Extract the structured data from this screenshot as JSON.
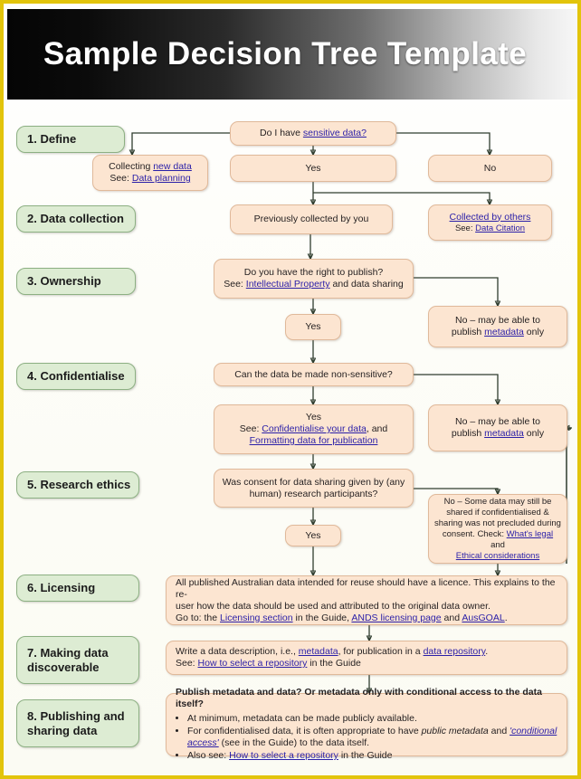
{
  "header": {
    "title": "Sample Decision Tree Template"
  },
  "theme": {
    "border_color": "#e2c40b",
    "stage_fill": "#ddecd3",
    "flow_fill": "#fce5d1",
    "link_color": "#2a1fa8",
    "connector_color": "#2f3d2f"
  },
  "stages": [
    {
      "label": "1. Define"
    },
    {
      "label": "2. Data collection"
    },
    {
      "label": "3. Ownership"
    },
    {
      "label": "4. Confidentialise"
    },
    {
      "label": "5. Research ethics"
    },
    {
      "label": "6. Licensing"
    },
    {
      "label": "7. Making data discoverable"
    },
    {
      "label": "8. Publishing and sharing data"
    }
  ],
  "nodes": {
    "q_sensitive": {
      "pre": "Do I have ",
      "link": "sensitive data?",
      "post": ""
    },
    "collecting_new": {
      "line1_pre": "Collecting ",
      "line1_link": "new data",
      "line2_pre": "See: ",
      "line2_link": "Data planning"
    },
    "yes_sensitive": {
      "label": "Yes"
    },
    "no_sensitive": {
      "label": "No"
    },
    "prev_collected": {
      "label": "Previously collected by you"
    },
    "collected_others": {
      "line1_link": "Collected by others",
      "line2_pre": "See: ",
      "line2_link": "Data Citation"
    },
    "q_right_publish": {
      "line1": "Do you have the right to publish?",
      "line2_pre": "See: ",
      "line2_link": "Intellectual Property",
      "line2_post": " and data sharing"
    },
    "yes_ownership": {
      "label": "Yes"
    },
    "no_metadata_1": {
      "line1": "No – may be able to",
      "line2_pre": "publish ",
      "line2_link": "metadata",
      "line2_post": " only"
    },
    "q_non_sensitive": {
      "label": "Can the data be made non-sensitive?"
    },
    "yes_confidentialise": {
      "line1": "Yes",
      "line2_pre": "See: ",
      "line2_link": "Confidentialise your data",
      "line2_post": ", and",
      "line3_link": "Formatting data for publication"
    },
    "no_metadata_2": {
      "line1": "No – may be able to",
      "line2_pre": "publish ",
      "line2_link": "metadata",
      "line2_post": " only"
    },
    "q_consent": {
      "line1": "Was consent for data sharing given by (any",
      "line2": "human) research participants?"
    },
    "yes_ethics": {
      "label": "Yes"
    },
    "no_some_data": {
      "line1": "No – Some data may still be",
      "line2": "shared if confidentialised &",
      "line3": "sharing was not precluded during",
      "line4_pre": "consent. Check: ",
      "line4_link": "What's legal",
      "line4_post": " and",
      "line5_link": "Ethical considerations"
    },
    "licensing": {
      "line1": "All published Australian data intended for reuse should have a licence. This explains to the re-",
      "line2": "user how the data should be used and attributed to the original data owner.",
      "line3_pre": "Go to: the ",
      "line3_link1": "Licensing section",
      "line3_mid1": " in the Guide, ",
      "line3_link2": "ANDS licensing page",
      "line3_mid2": " and ",
      "line3_link3": "AusGOAL",
      "line3_post": "."
    },
    "discoverable": {
      "line1_pre": "Write a data description, i.e., ",
      "line1_link1": "metadata",
      "line1_mid": ", for publication in a ",
      "line1_link2": "data repository",
      "line1_post": ".",
      "line2_pre": "See: ",
      "line2_link": "How to select a repository",
      "line2_post": " in the Guide"
    },
    "publishing": {
      "heading": "Publish metadata and data? Or metadata only with conditional access to the data itself?",
      "bullet1": "At minimum, metadata can be made publicly available.",
      "bullet2_pre": "For confidentialised data, it is often appropriate to have ",
      "bullet2_it": "public metadata",
      "bullet2_mid": " and ",
      "bullet2_link": "'conditional access'",
      "bullet2_post": " (see in the Guide) to the data itself.",
      "bullet3_pre": "Also see: ",
      "bullet3_link": "How to select a repository",
      "bullet3_post": " in the Guide"
    }
  }
}
